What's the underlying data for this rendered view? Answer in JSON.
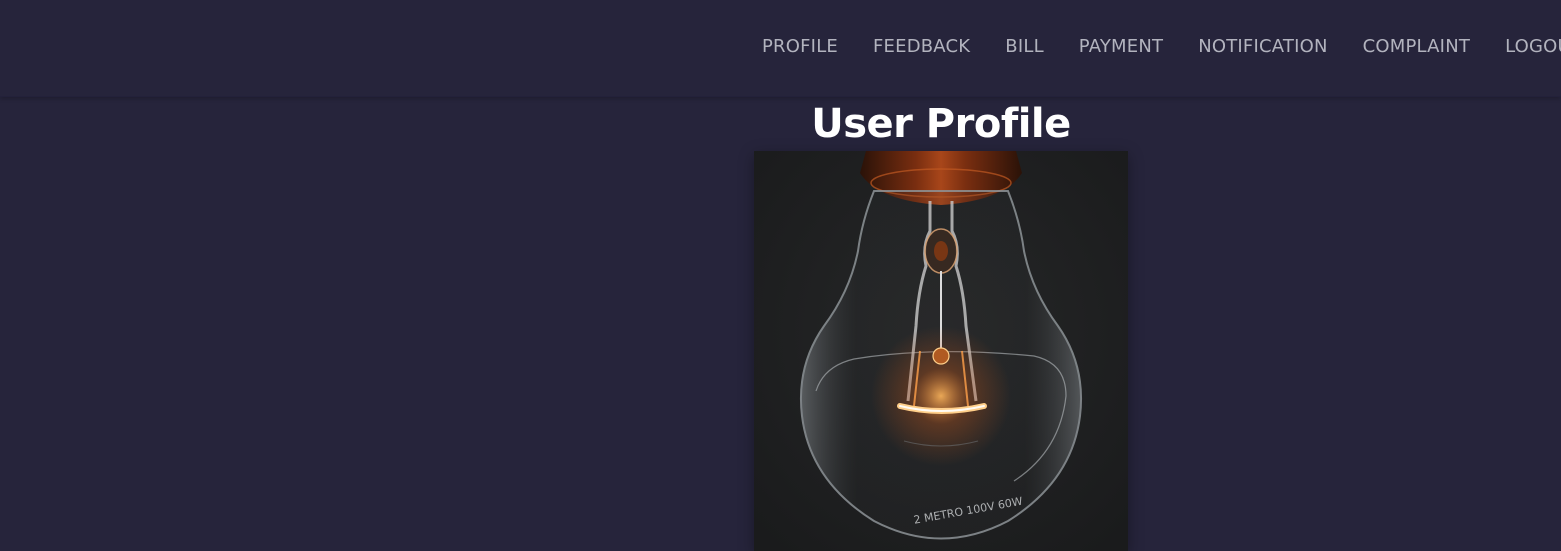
{
  "nav": {
    "items": [
      {
        "label": "PROFILE"
      },
      {
        "label": "FEEDBACK"
      },
      {
        "label": "BILL"
      },
      {
        "label": "PAYMENT"
      },
      {
        "label": "NOTIFICATION"
      },
      {
        "label": "COMPLAINT"
      },
      {
        "label": "LOGOUT"
      }
    ]
  },
  "page": {
    "title": "User Profile"
  },
  "profile_image": {
    "subject": "incandescent light bulb with glowing filament",
    "bulb_text": "2 METRO 100V 60W"
  },
  "colors": {
    "background": "#26243b",
    "nav_text": "#b2b3be",
    "title_text": "#ffffff",
    "filament_glow": "#ff9a3c"
  }
}
